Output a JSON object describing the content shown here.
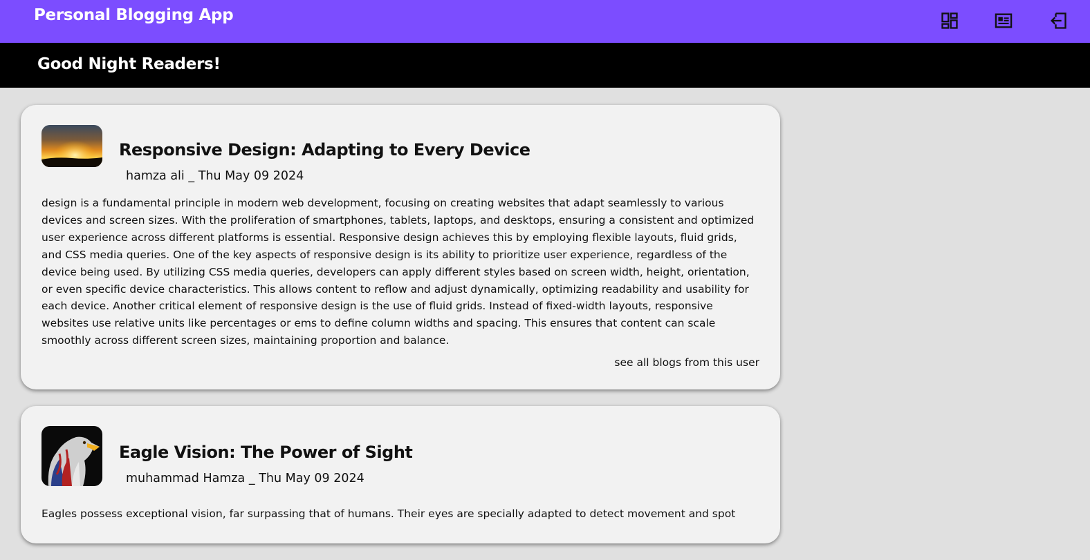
{
  "header": {
    "app_title": "Personal Blogging App",
    "nav_icons": [
      "dashboard-icon",
      "article-icon",
      "logout-icon"
    ],
    "accent_color": "#7c4dff"
  },
  "greeting": {
    "text": "Good Night Readers!",
    "background": "#000000"
  },
  "posts": [
    {
      "title": "Responsive Design: Adapting to Every Device",
      "author": "hamza ali",
      "separator": "_",
      "date": "Thu May 09 2024",
      "thumbnail": "sunset-landscape-image",
      "body": "design is a fundamental principle in modern web development, focusing on creating websites that adapt seamlessly to various devices and screen sizes. With the proliferation of smartphones, tablets, laptops, and desktops, ensuring a consistent and optimized user experience across different platforms is essential. Responsive design achieves this by employing flexible layouts, fluid grids, and CSS media queries. One of the key aspects of responsive design is its ability to prioritize user experience, regardless of the device being used. By utilizing CSS media queries, developers can apply different styles based on screen width, height, orientation, or even specific device characteristics. This allows content to reflow and adjust dynamically, optimizing readability and usability for each device. Another critical element of responsive design is the use of fluid grids. Instead of fixed-width layouts, responsive websites use relative units like percentages or ems to define column widths and spacing. This ensures that content can scale smoothly across different screen sizes, maintaining proportion and balance.",
      "see_all_label": "see all blogs from this user"
    },
    {
      "title": "Eagle Vision: The Power of Sight",
      "author": "muhammad Hamza",
      "separator": "_",
      "date": "Thu May 09 2024",
      "thumbnail": "eagle-flag-image",
      "body": "Eagles possess exceptional vision, far surpassing that of humans. Their eyes are specially adapted to detect movement and spot"
    }
  ]
}
